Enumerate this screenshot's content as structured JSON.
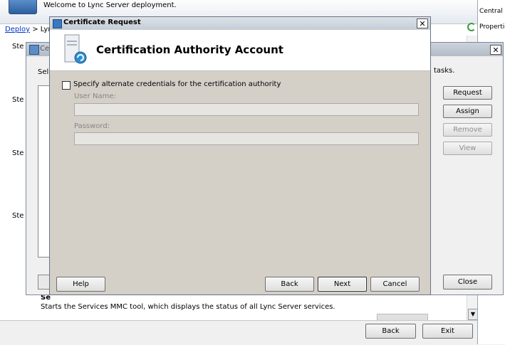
{
  "deployment": {
    "welcome": "Welcome to Lync Server deployment.",
    "breadcrumb_link": "Deploy",
    "breadcrumb_rest": " > Lync",
    "step_prefix": "Ste",
    "section_prefix": "Se",
    "services_desc": "Starts the Services MMC tool, which displays the status of all Lync Server services.",
    "back_label": "Back",
    "exit_label": "Exit"
  },
  "right_panel": {
    "item1": "Central S",
    "item2": "Propertie"
  },
  "cert_wizard_behind": {
    "title_prefix": "Ce",
    "desc_prefix": "Sel",
    "desc_suffix": "tasks.",
    "request_label": "Request",
    "assign_label": "Assign",
    "remove_label": "Remove",
    "view_label": "View",
    "close_label": "Close"
  },
  "dialog": {
    "title": "Certificate Request",
    "heading": "Certification Authority Account",
    "checkbox_label": "Specify alternate credentials for the certification authority",
    "checkbox_checked": false,
    "username_label": "User Name:",
    "username_value": "",
    "password_label": "Password:",
    "password_value": "",
    "help_label": "Help",
    "back_label": "Back",
    "next_label": "Next",
    "cancel_label": "Cancel"
  }
}
